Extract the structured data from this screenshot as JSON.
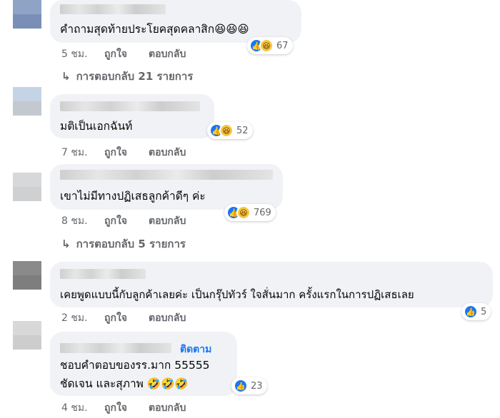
{
  "comments": [
    {
      "text_lines": [
        "คำถามสุดท้ายประโยคสุดคลาสิก😆😆😆"
      ],
      "reactions": {
        "types": [
          "like",
          "haha"
        ],
        "count": "67"
      },
      "time": "5 ชม.",
      "more_replies": "การตอบกลับ 21 รายการ"
    },
    {
      "text_lines": [
        "มติเป็นเอกฉันท์"
      ],
      "reactions": {
        "types": [
          "like",
          "haha"
        ],
        "count": "52"
      },
      "time": "7 ชม."
    },
    {
      "text_lines": [
        "เขาไม่มีทางปฏิเสธลูกค้าดีๆ ค่ะ"
      ],
      "reactions": {
        "types": [
          "like",
          "haha"
        ],
        "count": "769"
      },
      "time": "8 ชม.",
      "more_replies": "การตอบกลับ 5 รายการ"
    },
    {
      "text_lines": [
        "เคยพูดแบบนี้กับลูกค้าเลยค่ะ เป็นกรุ๊ปทัวร์ ใจสั่นมาก ครั้งแรกในการปฏิเสธเลย"
      ],
      "reactions": {
        "types": [
          "like"
        ],
        "count": "5"
      },
      "time": "2 ชม."
    },
    {
      "follow_label": "ติดตาม",
      "text_lines": [
        "ชอบคำตอบของรร.มาก 55555",
        "ชัดเจน และสุภาพ 🤣🤣🤣"
      ],
      "reactions": {
        "types": [
          "like"
        ],
        "count": "23"
      },
      "time": "4 ชม."
    }
  ],
  "actions": {
    "like": "ถูกใจ",
    "reply": "ตอบกลับ"
  },
  "icons": {
    "reply_arrow": "↳",
    "like": "👍",
    "haha": "😆"
  },
  "colors": {
    "accent": "#1877f2",
    "bubble": "#f0f2f5",
    "meta": "#65676b"
  }
}
